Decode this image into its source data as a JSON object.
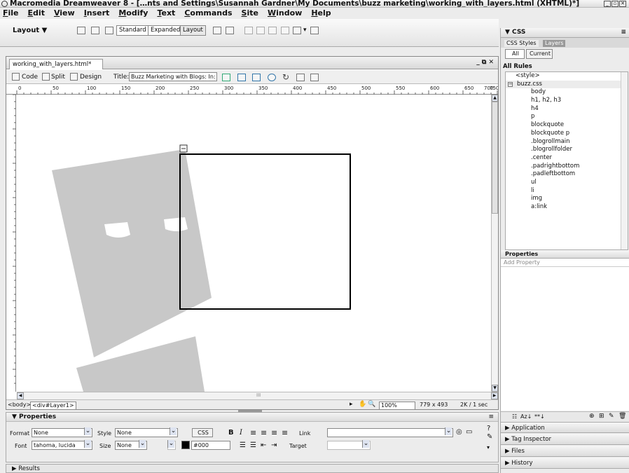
{
  "titlebar": {
    "title": "Macromedia Dreamweaver 8 - […nts and Settings\\Susannah Gardner\\My Documents\\buzz marketing\\working_with_layers.html (XHTML)*]"
  },
  "menu": [
    "File",
    "Edit",
    "View",
    "Insert",
    "Modify",
    "Text",
    "Commands",
    "Site",
    "Window",
    "Help"
  ],
  "insert_bar": {
    "category": "Layout ▼",
    "modes": [
      "Standard",
      "Expanded",
      "Layout"
    ]
  },
  "document": {
    "tab": "working_with_layers.html*",
    "views": [
      "Code",
      "Split",
      "Design"
    ],
    "title_label": "Title:",
    "title_value": "Buzz Marketing with Blogs: In:",
    "ruler_ticks": [
      "0",
      "50",
      "100",
      "150",
      "200",
      "250",
      "300",
      "350",
      "400",
      "450",
      "500",
      "550",
      "600",
      "650",
      "700",
      "750"
    ],
    "window_controls": "_ ⧉ ✕",
    "hscroll_mark": "III"
  },
  "status": {
    "tag1": "<body>",
    "tag2": "<div#Layer1>",
    "zoom": "100%",
    "size": "779 x 493",
    "download": "2K / 1 sec"
  },
  "properties": {
    "header": "▼ Properties",
    "format_label": "Format",
    "format_value": "None",
    "style_label": "Style",
    "style_value": "None",
    "css_button": "CSS",
    "bold": "B",
    "italic": "I",
    "link_label": "Link",
    "font_label": "Font",
    "font_value": "tahoma, lucida",
    "size_label": "Size",
    "size_value": "None",
    "color_value": "#000",
    "target_label": "Target"
  },
  "results": {
    "label": "▶ Results"
  },
  "css_panel": {
    "header": "▼ CSS",
    "tabs": [
      "CSS Styles",
      "Layers"
    ],
    "modes": [
      "All",
      "Current"
    ],
    "all_rules": "All Rules",
    "rules": [
      "<style>",
      "buzz.css",
      "body",
      "h1, h2, h3",
      "h4",
      "p",
      "blockquote",
      "blockquote p",
      ".blogrollmain",
      ".blogrollfolder",
      ".center",
      ".padrightbottom",
      ".padleftbottom",
      "ul",
      "li",
      "img",
      "a:link"
    ],
    "properties_header": "Properties",
    "add_property": "Add Property"
  },
  "collapsed_panels": [
    "▶ Application",
    "▶ Tag Inspector",
    "▶ Files",
    "▶ History"
  ]
}
